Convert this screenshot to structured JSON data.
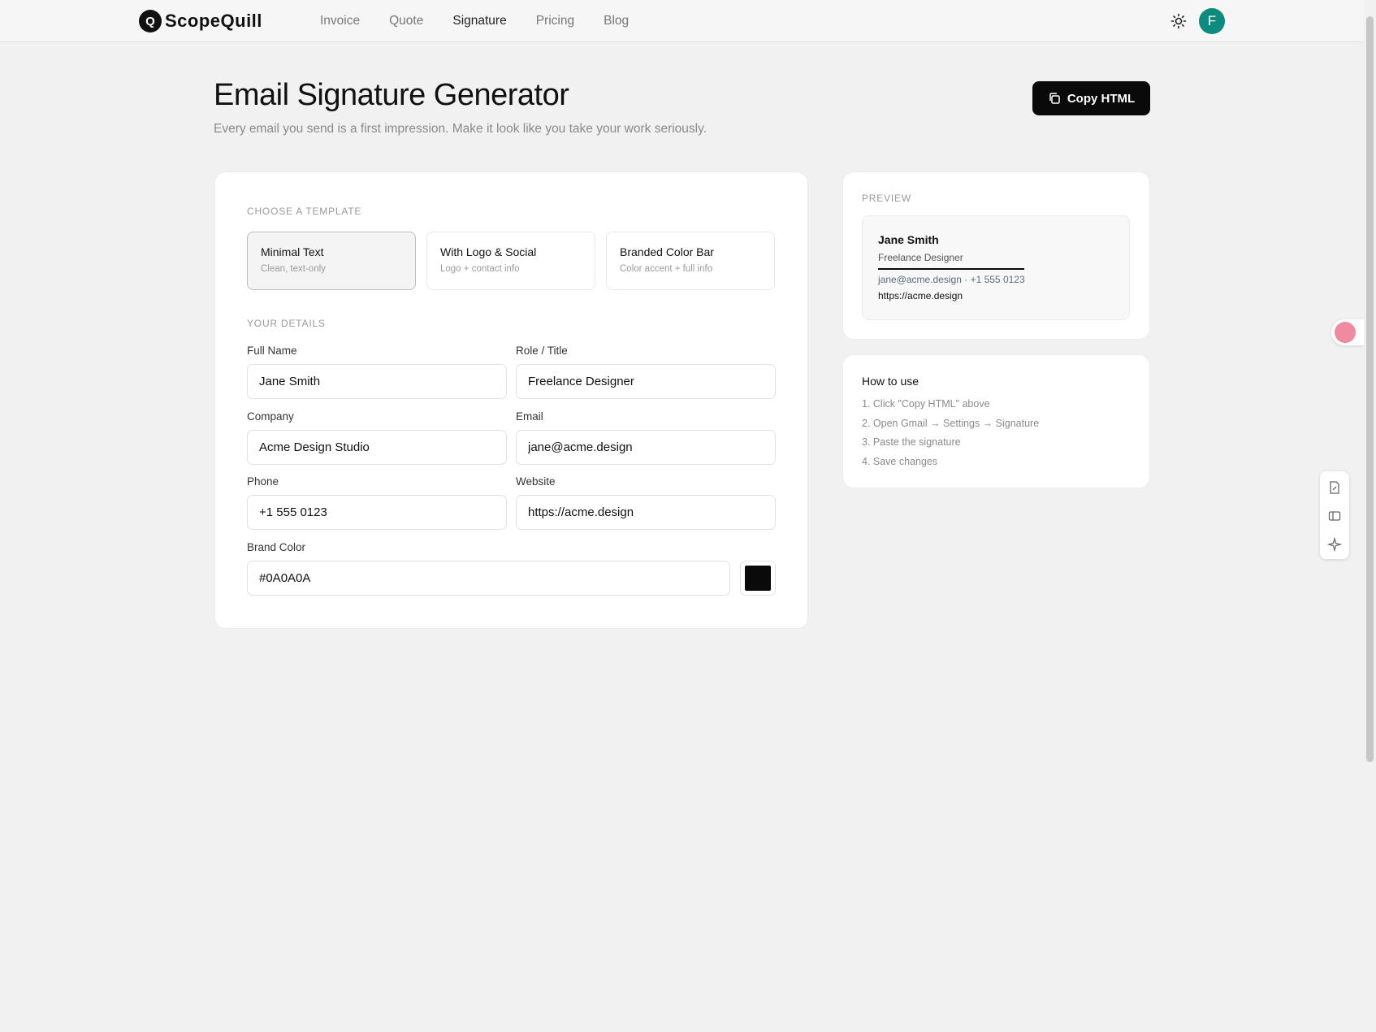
{
  "nav": {
    "logo_mark": "Q",
    "logo_text": "ScopeQuill",
    "links": [
      "Invoice",
      "Quote",
      "Signature",
      "Pricing",
      "Blog"
    ],
    "active": "Signature",
    "avatar_initial": "F"
  },
  "header": {
    "title": "Email Signature Generator",
    "subtitle": "Every email you send is a first impression. Make it look like you take your work seriously.",
    "copy_label": "Copy HTML"
  },
  "templates": {
    "section_label": "CHOOSE A TEMPLATE",
    "items": [
      {
        "title": "Minimal Text",
        "subtitle": "Clean, text-only",
        "selected": true
      },
      {
        "title": "With Logo & Social",
        "subtitle": "Logo + contact info",
        "selected": false
      },
      {
        "title": "Branded Color Bar",
        "subtitle": "Color accent + full info",
        "selected": false
      }
    ]
  },
  "details": {
    "section_label": "YOUR DETAILS",
    "full_name": {
      "label": "Full Name",
      "value": "Jane Smith"
    },
    "role": {
      "label": "Role / Title",
      "value": "Freelance Designer"
    },
    "company": {
      "label": "Company",
      "value": "Acme Design Studio"
    },
    "email": {
      "label": "Email",
      "value": "jane@acme.design"
    },
    "phone": {
      "label": "Phone",
      "value": "+1 555 0123"
    },
    "website": {
      "label": "Website",
      "value": "https://acme.design"
    },
    "brand_color": {
      "label": "Brand Color",
      "value": "#0A0A0A"
    }
  },
  "preview": {
    "section_label": "PREVIEW",
    "name": "Jane Smith",
    "role": "Freelance Designer",
    "contact": "jane@acme.design · +1 555 0123",
    "website": "https://acme.design"
  },
  "howto": {
    "title": "How to use",
    "steps": [
      "1. Click \"Copy HTML\" above",
      "2. Open Gmail → Settings → Signature",
      "3. Paste the signature",
      "4. Save changes"
    ]
  },
  "colors": {
    "accent": "#0a0a0a",
    "avatar": "#0f8a7e",
    "background": "#f1f1f1"
  },
  "icons": [
    "sun-icon",
    "copy-icon",
    "translate-icon",
    "edit-doc-icon",
    "sidebar-icon",
    "sparkle-icon"
  ]
}
